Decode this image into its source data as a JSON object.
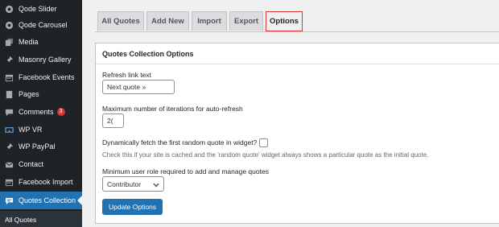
{
  "sidebar": {
    "items": [
      {
        "label": "Qode Slider",
        "icon": "slider-icon"
      },
      {
        "label": "Qode Carousel",
        "icon": "carousel-icon"
      },
      {
        "label": "Media",
        "icon": "media-icon"
      },
      {
        "label": "Masonry Gallery",
        "icon": "pin-icon"
      },
      {
        "label": "Facebook Events",
        "icon": "calendar-icon"
      },
      {
        "label": "Pages",
        "icon": "page-icon"
      },
      {
        "label": "Comments",
        "icon": "comment-icon",
        "badge": "3"
      },
      {
        "label": "WP VR",
        "icon": "vr-icon"
      },
      {
        "label": "WP PayPal",
        "icon": "pin-icon"
      },
      {
        "label": "Contact",
        "icon": "envelope-icon"
      },
      {
        "label": "Facebook Import",
        "icon": "calendar-icon"
      },
      {
        "label": "Quotes Collection",
        "icon": "quote-icon",
        "active": true
      }
    ],
    "submenu": {
      "label": "All Quotes"
    }
  },
  "tabs": [
    {
      "label": "All Quotes"
    },
    {
      "label": "Add New"
    },
    {
      "label": "Import"
    },
    {
      "label": "Export"
    },
    {
      "label": "Options",
      "active": true
    }
  ],
  "panel": {
    "title": "Quotes Collection Options",
    "refresh_label": "Refresh link text",
    "refresh_value": "Next quote »",
    "iterations_label": "Maximum number of iterations for auto-refresh",
    "iterations_value": "2(",
    "dynamic_label": "Dynamically fetch the first random quote in widget?",
    "dynamic_checked": false,
    "dynamic_help": "Check this if your site is cached and the 'random quote' widget always shows a particular quote as the initial quote.",
    "role_label": "Minimum user role required to add and manage quotes",
    "role_value": "Contributor",
    "update_button": "Update Options"
  },
  "colors": {
    "sidebar_bg": "#1d2327",
    "active": "#2271b1",
    "badge": "#d63638",
    "tab_highlight": "#d63638"
  }
}
